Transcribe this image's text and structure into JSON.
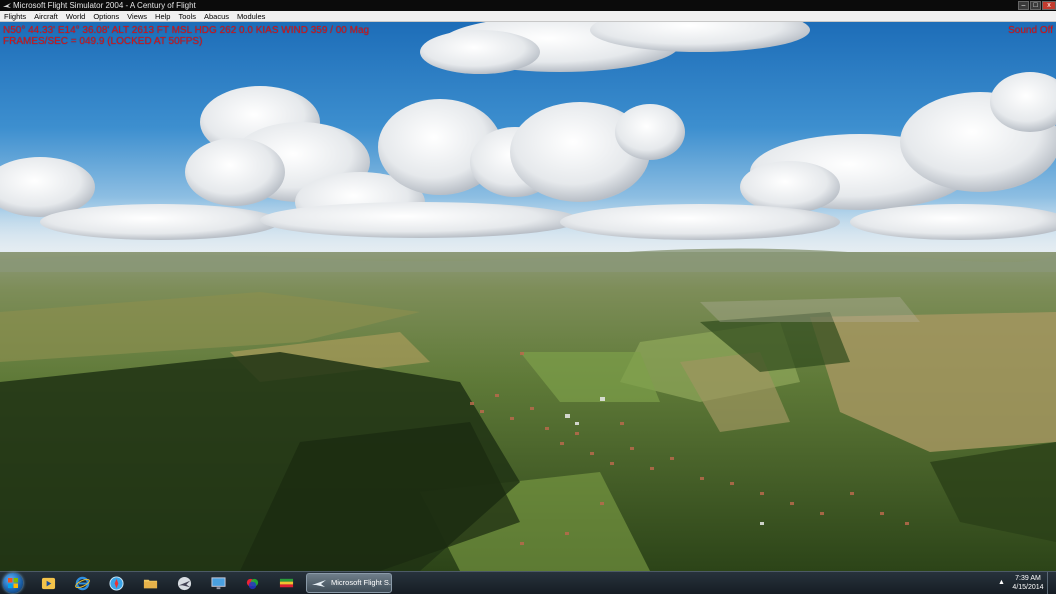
{
  "window": {
    "title": "Microsoft Flight Simulator 2004 - A Century of Flight",
    "buttons": {
      "minimize": "–",
      "maximize": "□",
      "close": "x"
    }
  },
  "menu": {
    "items": [
      "Flights",
      "Aircraft",
      "World",
      "Options",
      "Views",
      "Help",
      "Tools",
      "Abacus",
      "Modules"
    ]
  },
  "hud": {
    "line1": "N50° 44.33'  E14° 36.08'  ALT  2613 FT  MSL  HDG 262   0.0 KIAS  WIND 359 / 00 Mag",
    "line2": "FRAMES/SEC = 049.9 (LOCKED AT 50FPS)",
    "sound": "Sound Off",
    "color": "#e01010"
  },
  "taskbar": {
    "pinned_icons": [
      "windows-media-player-icon",
      "internet-explorer-icon",
      "safari-icon",
      "file-explorer-icon",
      "flight-app-icon",
      "monitor-app-icon",
      "color-wheel-icon",
      "flag-app-icon"
    ],
    "active_task": "Microsoft Flight S...",
    "tray_arrow": "▲",
    "clock": {
      "time": "7:39 AM",
      "date": "4/15/2014"
    }
  }
}
